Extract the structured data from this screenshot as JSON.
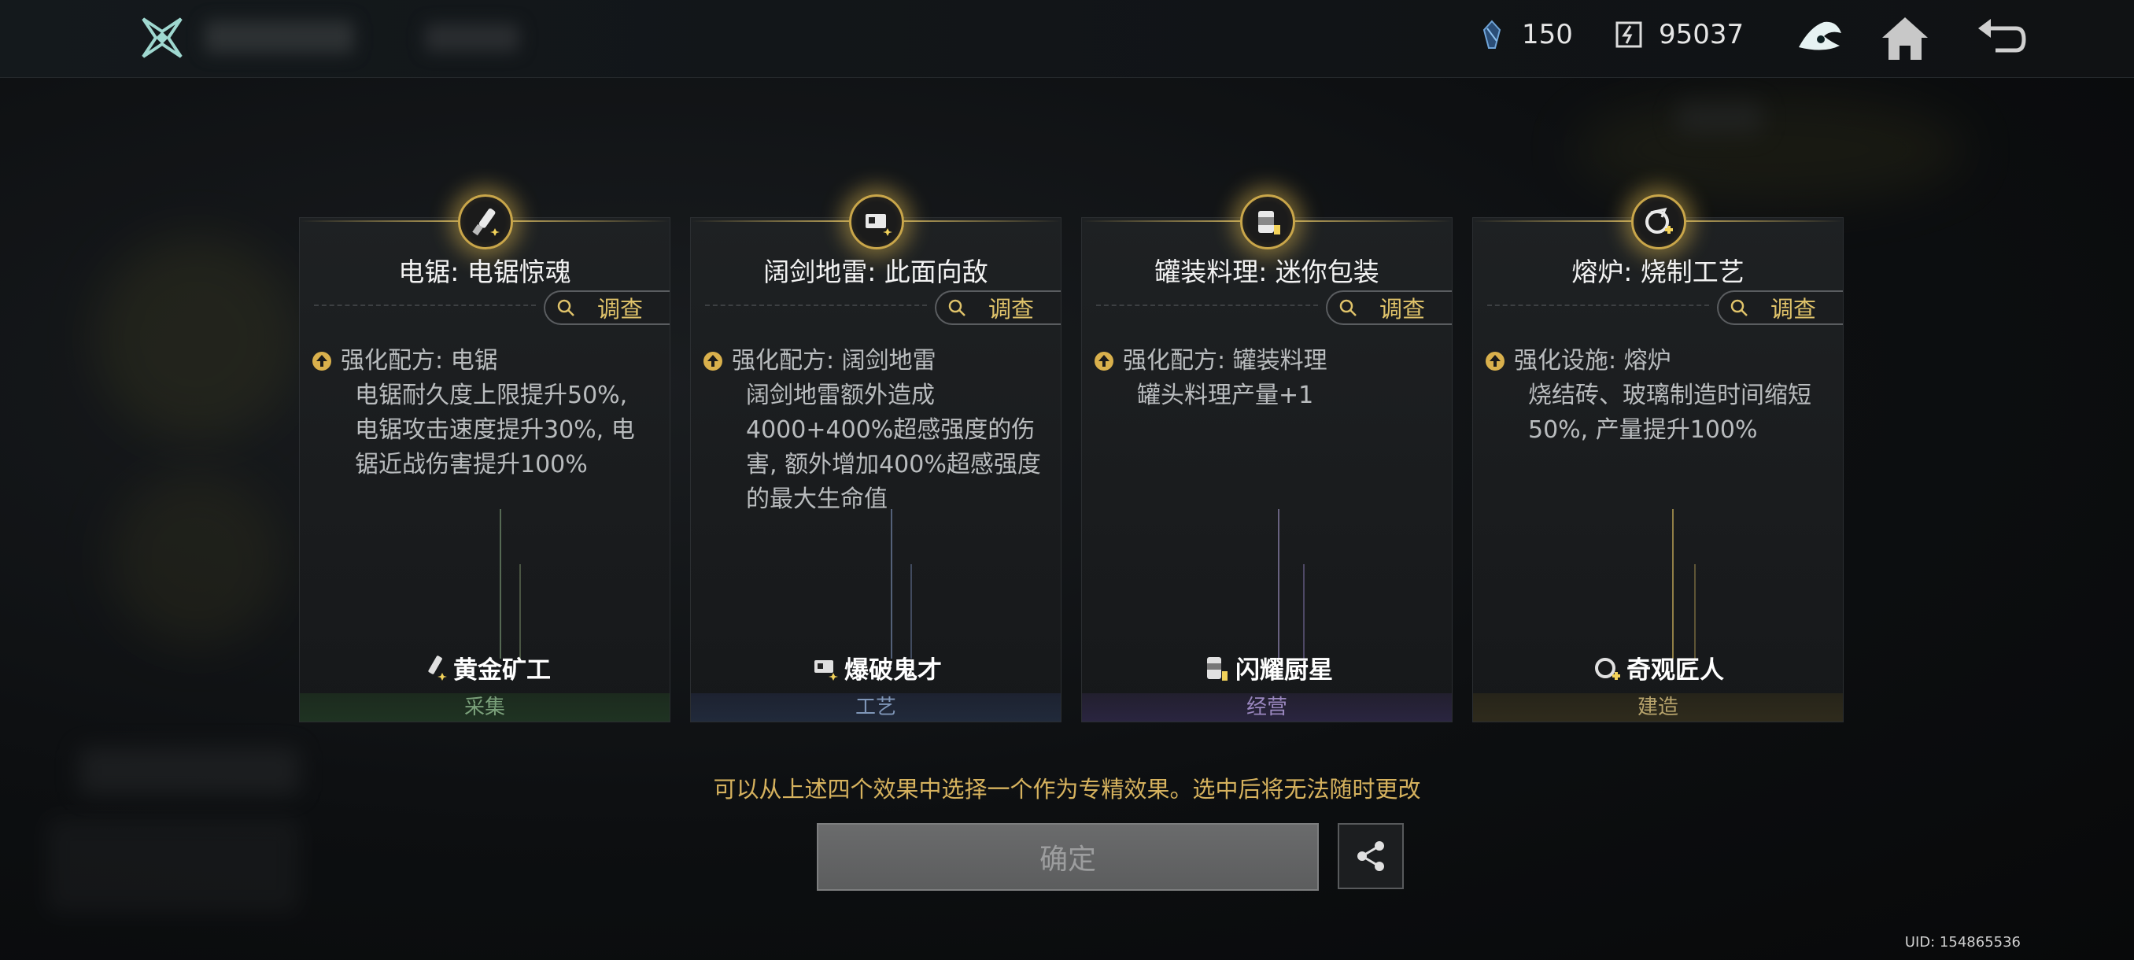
{
  "topbar": {
    "currency_a": "150",
    "currency_b": "95037"
  },
  "cards": [
    {
      "title": "电锯: 电锯惊魂",
      "investigate": "调查",
      "desc_head": "强化配方: 电锯",
      "desc_body": "电锯耐久度上限提升50%, 电锯攻击速度提升30%, 电锯近战伤害提升100%",
      "role": "黄金矿工",
      "category": "采集",
      "category_color": "#7aa07a"
    },
    {
      "title": "阔剑地雷: 此面向敌",
      "investigate": "调查",
      "desc_head": "强化配方: 阔剑地雷",
      "desc_body": "阔剑地雷额外造成4000+400%超感强度的伤害, 额外增加400%超感强度的最大生命值",
      "role": "爆破鬼才",
      "category": "工艺",
      "category_color": "#7f96b8"
    },
    {
      "title": "罐装料理: 迷你包装",
      "investigate": "调查",
      "desc_head": "强化配方: 罐装料理",
      "desc_body": "罐头料理产量+1",
      "role": "闪耀厨星",
      "category": "经营",
      "category_color": "#9a87bf"
    },
    {
      "title": "熔炉: 烧制工艺",
      "investigate": "调查",
      "desc_head": "强化设施: 熔炉",
      "desc_body": "烧结砖、玻璃制造时间缩短50%, 产量提升100%",
      "role": "奇观匠人",
      "category": "建造",
      "category_color": "#b7a36c"
    }
  ],
  "notice": "可以从上述四个效果中选择一个作为专精效果。选中后将无法随时更改",
  "confirm_label": "确定",
  "uid": "UID: 154865536"
}
